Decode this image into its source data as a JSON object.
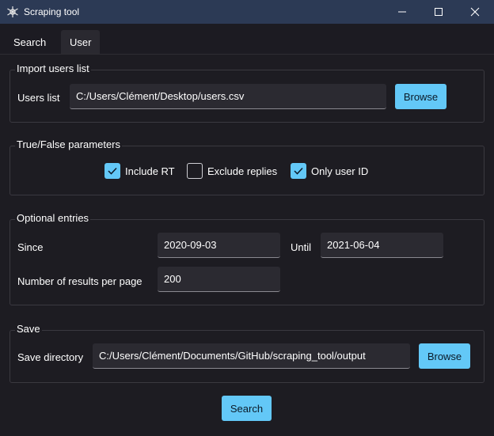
{
  "window": {
    "title": "Scraping tool",
    "icon": "app-logo-icon",
    "controls": [
      "minimize-icon",
      "maximize-icon",
      "close-icon"
    ]
  },
  "tabs": [
    {
      "label": "Search",
      "active": false
    },
    {
      "label": "User",
      "active": true
    }
  ],
  "import_users": {
    "title": "Import users list",
    "users_list_label": "Users list",
    "users_list_value": "C:/Users/Clément/Desktop/users.csv",
    "browse_label": "Browse"
  },
  "true_false": {
    "title": "True/False parameters",
    "options": [
      {
        "label": "Include RT",
        "checked": true
      },
      {
        "label": "Exclude replies",
        "checked": false
      },
      {
        "label": "Only user ID",
        "checked": true
      }
    ]
  },
  "optional": {
    "title": "Optional entries",
    "since_label": "Since",
    "since_value": "2020-09-03",
    "until_label": "Until",
    "until_value": "2021-06-04",
    "results_label": "Number of results per page",
    "results_value": "200"
  },
  "save": {
    "title": "Save",
    "dir_label": "Save directory",
    "dir_value": "C:/Users/Clément/Documents/GitHub/scraping_tool/output",
    "browse_label": "Browse"
  },
  "search_button_label": "Search",
  "colors": {
    "accent": "#63c8f7",
    "titlebar": "#2c3a55",
    "background": "#1d1c22"
  }
}
